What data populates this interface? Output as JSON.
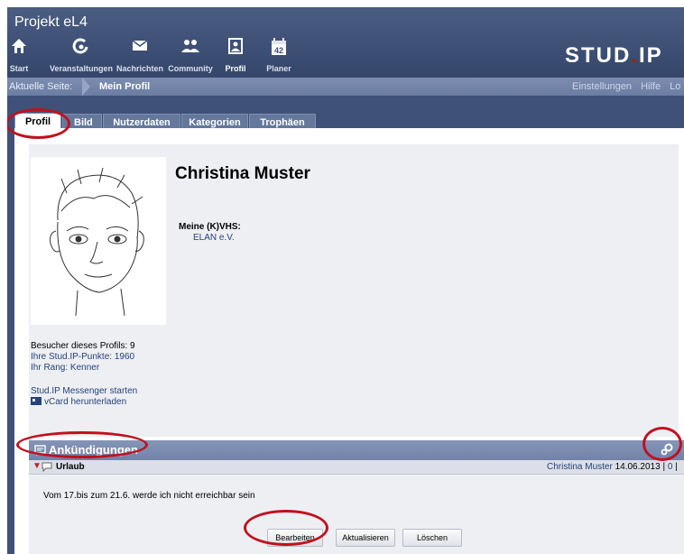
{
  "header": {
    "site_title": "Projekt eL4",
    "brand_main": "STUD",
    "brand_dot": ".",
    "brand_end": "IP",
    "nav": [
      {
        "label": "Start",
        "icon": "home-icon"
      },
      {
        "label": "Veranstaltungen",
        "icon": "courses-icon"
      },
      {
        "label": "Nachrichten",
        "icon": "mail-icon"
      },
      {
        "label": "Community",
        "icon": "community-icon"
      },
      {
        "label": "Profil",
        "icon": "profile-icon"
      },
      {
        "label": "Planer",
        "icon": "calendar-icon",
        "calendar_day": "42"
      }
    ]
  },
  "breadcrumb": {
    "label": "Aktuelle Seite:",
    "current": "Mein Profil",
    "right_links": [
      "Einstellungen",
      "Hilfe",
      "Lo"
    ]
  },
  "tabs": [
    {
      "label": "Profil",
      "active": true
    },
    {
      "label": "Bild"
    },
    {
      "label": "Nutzerdaten"
    },
    {
      "label": "Kategorien"
    },
    {
      "label": "Trophäen"
    }
  ],
  "profile": {
    "name": "Christina Muster",
    "vhs_label": "Meine (K)VHS:",
    "vhs_link": "ELAN e.V.",
    "visitors": "Besucher dieses Profils: 9",
    "points": "Ihre Stud.IP-Punkte: 1960",
    "rank": "Ihr Rang: Kenner",
    "messenger": "Stud.IP Messenger starten",
    "vcard": "vCard herunterladen"
  },
  "announcements": {
    "title": "Ankündigungen",
    "item": {
      "title": "Urlaub",
      "author": "Christina Muster",
      "date": "14.06.2013",
      "sep1": "|",
      "count": "0",
      "sep2": "|",
      "text": "Vom 17.bis zum 21.6. werde ich nicht erreichbar sein"
    },
    "buttons": {
      "edit": "Bearbeiten",
      "refresh": "Aktualisieren",
      "delete": "Löschen"
    }
  },
  "colors": {
    "header_bg": "#3d4f74",
    "link": "#24437a",
    "highlight_ring": "#c0111e",
    "panel_bg": "#eeeff3"
  }
}
